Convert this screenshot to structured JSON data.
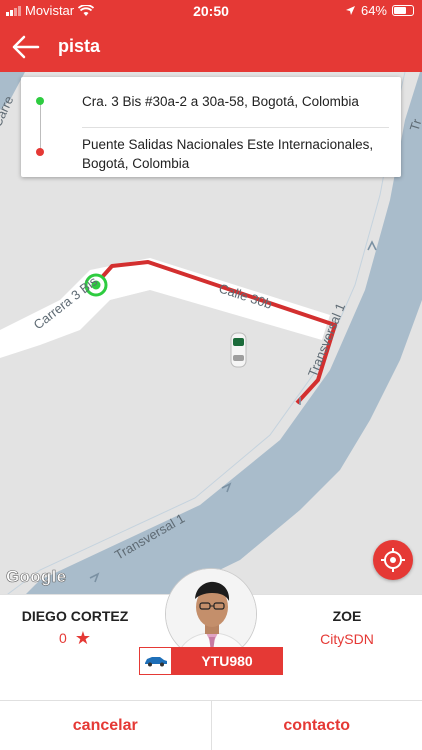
{
  "status_bar": {
    "carrier": "Movistar",
    "time": "20:50",
    "battery": "64%",
    "battery_level": 0.64,
    "signal_icon": "signal-icon",
    "wifi_icon": "wifi-icon",
    "location_icon": "location-arrow-icon"
  },
  "header": {
    "title": "pista",
    "back_icon": "arrow-left-icon"
  },
  "map": {
    "street_labels": [
      "Carrera 3 Bis",
      "Calle 30b",
      "Transversal 1",
      "Transversal 1"
    ],
    "attribution": "Google",
    "route_color": "#d32f2f"
  },
  "route": {
    "origin": "Cra. 3 Bis #30a-2 a 30a-58, Bogotá, Colombia",
    "destination_line1": "Puente Salidas Nacionales Este Internacionales,",
    "destination_line2": "Bogotá, Colombia"
  },
  "driver": {
    "name": "DIEGO CORTEZ",
    "rating": "0",
    "star_icon": "star-icon",
    "company": "ZOE",
    "car_type": "CitySDN",
    "plate": "YTU980"
  },
  "actions": {
    "cancel": "cancelar",
    "contact": "contacto"
  },
  "colors": {
    "accent": "#e53935",
    "origin_dot": "#2ecc40",
    "road": "#a9bccb",
    "map_bg": "#e3e3e3"
  }
}
